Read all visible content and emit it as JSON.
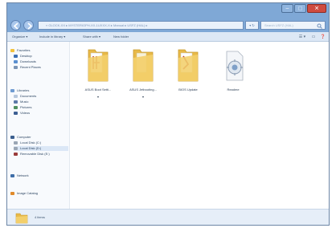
{
  "titlebar": {
    "minimize": "–",
    "maximize": "□",
    "close": "✕"
  },
  "address": {
    "path": "« GLOCK-XX ▸ MYSTERIOPH-XX-1UXXX-X ▸ Manual ▸ USFZ (HAL) ▸",
    "history_button": "▾ ↻",
    "search_placeholder": "Search USFZ (HAL)"
  },
  "toolbar": {
    "items": [
      "Organize ▾",
      "Include in library ▾",
      "Share with ▾",
      "New folder"
    ],
    "view_icon": "☰ ▾",
    "pane_icon": "▭",
    "help_icon": "❓"
  },
  "nav": {
    "favorites": [
      "Favorites",
      "Desktop",
      "Downloads",
      "Recent Places"
    ],
    "libraries": [
      "Libraries",
      "Documents",
      "Music",
      "Pictures",
      "Videos"
    ],
    "computer": [
      "Computer",
      "Local Disk (C:)",
      "Local Disk (D:)",
      "Removable Disk (E:)"
    ],
    "network": "Network",
    "extra": "Image Catalog"
  },
  "files": [
    {
      "name": "ASUS Boot Setti...",
      "mark": "▾",
      "icon": "folder-icon"
    },
    {
      "name": "ASUS Jetbooting...",
      "mark": "▾",
      "icon": "folder-icon"
    },
    {
      "name": "BIOS Update",
      "mark": "",
      "icon": "folder-icon"
    },
    {
      "name": "Readme",
      "mark": "",
      "icon": "setup-icon"
    }
  ],
  "details": {
    "count": "4 items"
  },
  "colors": {
    "titlebar": "#7fa8d6",
    "toolbar": "#dde8f5",
    "folder": "#f0c85a",
    "close": "#cf4b3f"
  }
}
